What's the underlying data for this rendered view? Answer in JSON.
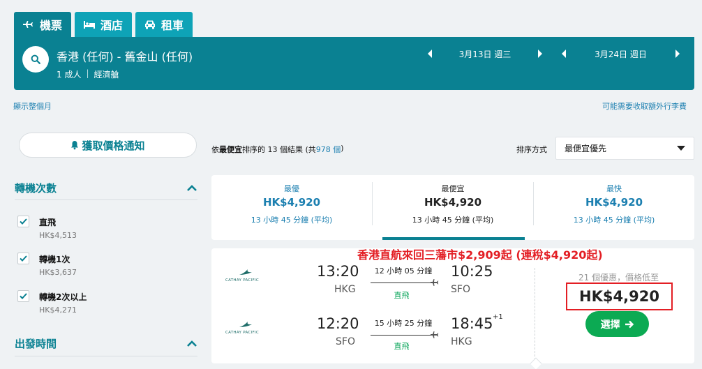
{
  "tabs": [
    {
      "label": "機票",
      "icon": "plane-icon",
      "active": true
    },
    {
      "label": "酒店",
      "icon": "bed-icon",
      "active": false
    },
    {
      "label": "租車",
      "icon": "car-icon",
      "active": false
    }
  ],
  "search": {
    "route": "香港 (任何) - 舊金山 (任何)",
    "passengers": "1 成人",
    "cabin": "經濟艙",
    "depart_date": "3月13日 週三",
    "return_date": "3月24日 週日"
  },
  "links": {
    "show_month": "顯示整個月",
    "baggage_fees": "可能需要收取額外行李費"
  },
  "price_alert": {
    "label": "獲取價格通知",
    "icon": "bell-icon"
  },
  "filters": {
    "stops": {
      "title": "轉機次數",
      "options": [
        {
          "label": "直飛",
          "price": "HK$4,513",
          "checked": true
        },
        {
          "label": "轉機1次",
          "price": "HK$3,637",
          "checked": true
        },
        {
          "label": "轉機2次以上",
          "price": "HK$4,271",
          "checked": true
        }
      ]
    },
    "departure_time": {
      "title": "出發時間"
    }
  },
  "results": {
    "prefix": "依",
    "sort_bold": "最便宜",
    "middle": "排序的 13 個結果 (共 ",
    "total": "978 個",
    "suffix": ")"
  },
  "sort": {
    "label": "排序方式",
    "value": "最便宜優先"
  },
  "sort_tabs": [
    {
      "title": "最優",
      "price": "HK$4,920",
      "duration": "13 小時 45 分鐘 (平均)",
      "active": false
    },
    {
      "title": "最便宜",
      "price": "HK$4,920",
      "duration": "13 小時 45 分鐘 (平均)",
      "active": true
    },
    {
      "title": "最快",
      "price": "HK$4,920",
      "duration": "13 小時 45 分鐘 (平均)",
      "active": false
    }
  ],
  "flight": {
    "airline": "CATHAY PACIFIC",
    "promo": "香港直航來回三藩市$2,909起 (連稅$4,920起)",
    "deals": "21 個優惠，價格低至",
    "price": "HK$4,920",
    "select_label": "選擇",
    "legs": [
      {
        "dep_time": "13:20",
        "dep_code": "HKG",
        "arr_time": "10:25",
        "arr_code": "SFO",
        "duration": "12 小時 05 分鐘",
        "stops": "直飛",
        "day_offset": ""
      },
      {
        "dep_time": "12:20",
        "dep_code": "SFO",
        "arr_time": "18:45",
        "arr_code": "HKG",
        "duration": "15 小時 25 分鐘",
        "stops": "直飛",
        "day_offset": "+1"
      }
    ]
  },
  "colors": {
    "teal_dark": "#0a8192",
    "teal": "#0ea3b7",
    "link": "#1b7fb0",
    "green": "#0caa53",
    "red": "#e31e24"
  }
}
